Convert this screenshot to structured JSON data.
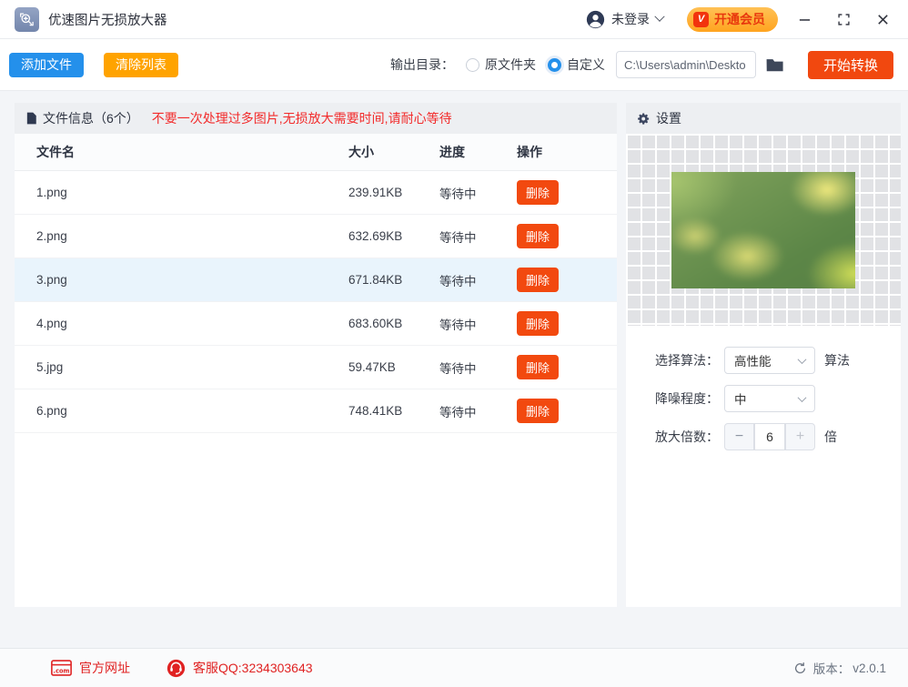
{
  "titlebar": {
    "app_title": "优速图片无损放大器",
    "login_label": "未登录",
    "vip_badge": "V",
    "vip_label": "开通会员"
  },
  "toolbar": {
    "add_files_label": "添加文件",
    "clear_list_label": "清除列表",
    "output_dir_label": "输出目录：",
    "radio_original_label": "原文件夹",
    "radio_custom_label": "自定义",
    "path_value": "C:\\Users\\admin\\Deskto",
    "start_label": "开始转换"
  },
  "file_panel": {
    "title": "文件信息（6个）",
    "warning": "不要一次处理过多图片,无损放大需要时间,请耐心等待",
    "columns": [
      "文件名",
      "大小",
      "进度",
      "操作"
    ],
    "delete_label": "删除",
    "rows": [
      {
        "name": "1.png",
        "size": "239.91KB",
        "status": "等待中",
        "selected": false
      },
      {
        "name": "2.png",
        "size": "632.69KB",
        "status": "等待中",
        "selected": false
      },
      {
        "name": "3.png",
        "size": "671.84KB",
        "status": "等待中",
        "selected": true
      },
      {
        "name": "4.png",
        "size": "683.60KB",
        "status": "等待中",
        "selected": false
      },
      {
        "name": "5.jpg",
        "size": "59.47KB",
        "status": "等待中",
        "selected": false
      },
      {
        "name": "6.png",
        "size": "748.41KB",
        "status": "等待中",
        "selected": false
      }
    ]
  },
  "settings_panel": {
    "title": "设置",
    "algorithm_label": "选择算法：",
    "algorithm_value": "高性能",
    "algorithm_suffix": "算法",
    "denoise_label": "降噪程度：",
    "denoise_value": "中",
    "scale_label": "放大倍数：",
    "scale_value": "6",
    "scale_suffix": "倍",
    "minus_label": "−",
    "plus_label": "+"
  },
  "footer": {
    "website_label": "官方网址",
    "qq_label": "客服QQ:3234303643",
    "version_label": "版本：",
    "version_value": "v2.0.1"
  },
  "colors": {
    "accent_blue": "#2490eb",
    "accent_orange": "#ffa300",
    "accent_red": "#f1480f",
    "delete_red": "#f2490f",
    "link_red": "#e02222",
    "warning_red": "#f22b2b",
    "row_selected": "#e9f4fc",
    "vip_pill_orange": "#ffab33",
    "vip_text_red": "#e8380d"
  }
}
